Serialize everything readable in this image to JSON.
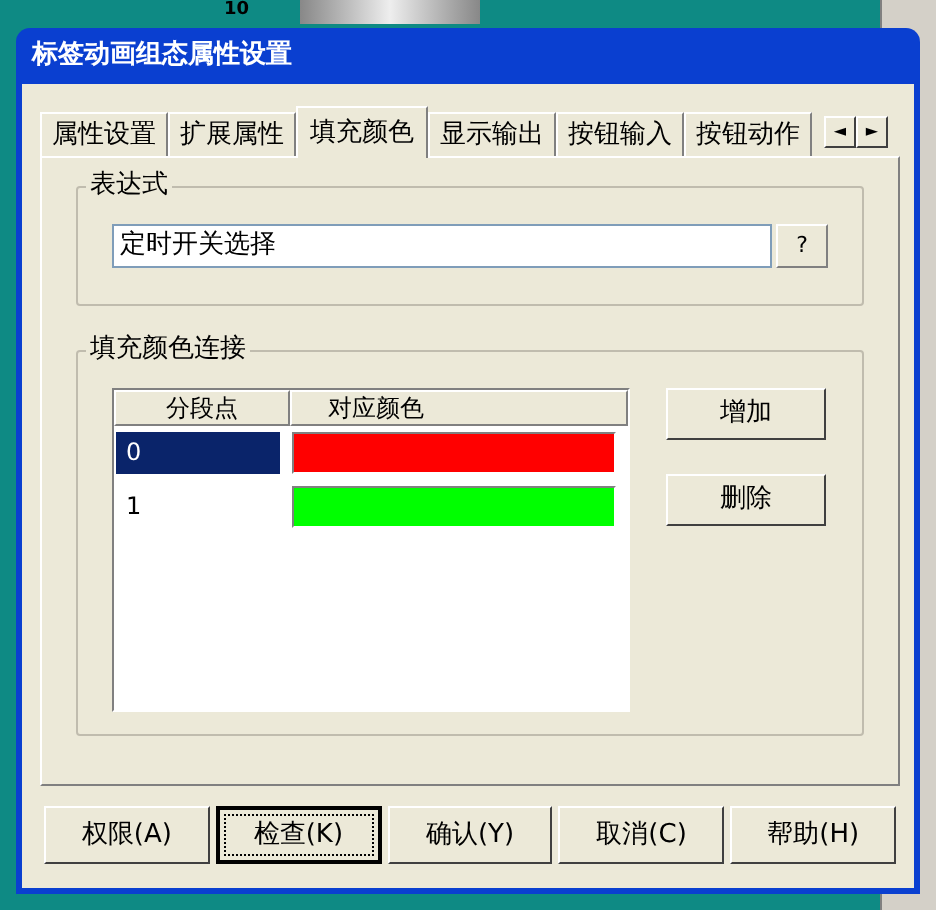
{
  "background": {
    "scale_label": "10"
  },
  "window": {
    "title": "标签动画组态属性设置"
  },
  "tabs": [
    {
      "label": "属性设置",
      "selected": false
    },
    {
      "label": "扩展属性",
      "selected": false
    },
    {
      "label": "填充颜色",
      "selected": true
    },
    {
      "label": "显示输出",
      "selected": false
    },
    {
      "label": "按钮输入",
      "selected": false
    },
    {
      "label": "按钮动作",
      "selected": false
    }
  ],
  "tab_scroll": [
    "◄",
    "►"
  ],
  "expression": {
    "legend": "表达式",
    "value": "定时开关选择",
    "browse_button": "?"
  },
  "fill_color": {
    "legend": "填充颜色连接",
    "table": {
      "columns": [
        "分段点",
        "对应颜色"
      ],
      "rows": [
        {
          "point": "0",
          "color": "#ff0000",
          "selected": true
        },
        {
          "point": "1",
          "color": "#00ff00",
          "selected": false
        }
      ]
    },
    "buttons": [
      "增加",
      "删除"
    ]
  },
  "footer_buttons": [
    {
      "label": "权限(A)",
      "default": false
    },
    {
      "label": "检查(K)",
      "default": true
    },
    {
      "label": "确认(Y)",
      "default": false
    },
    {
      "label": "取消(C)",
      "default": false
    },
    {
      "label": "帮助(H)",
      "default": false
    }
  ]
}
